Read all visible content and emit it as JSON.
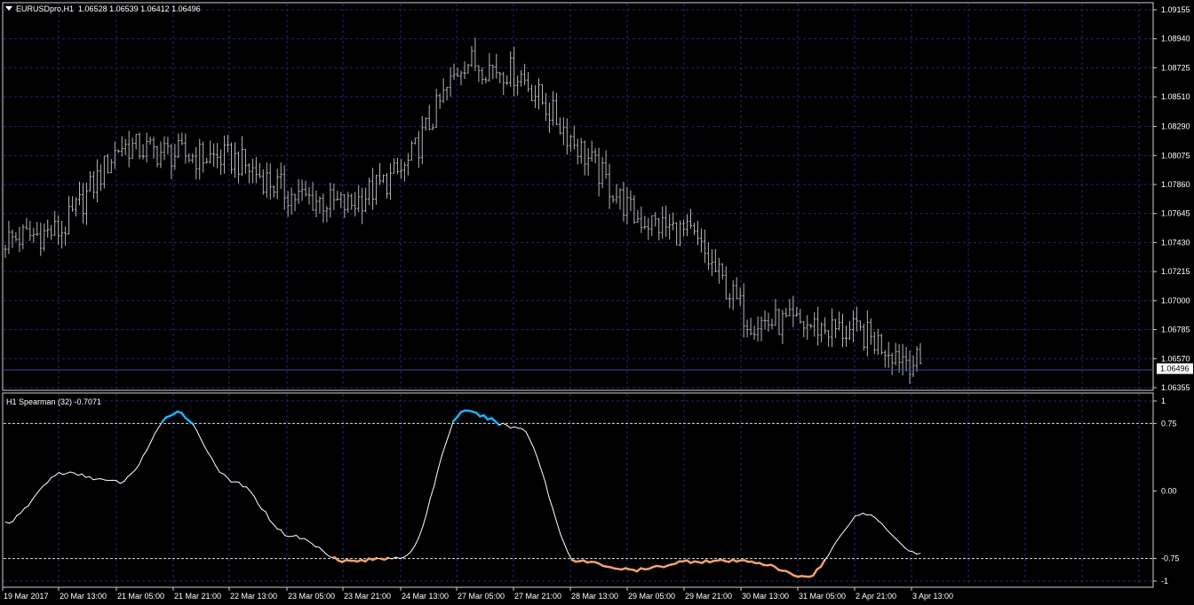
{
  "main": {
    "symbol": "EURUSDpro,H1",
    "ohlc": "1.06528 1.06539 1.06412 1.06496",
    "current_price": "1.06496",
    "price_ticks": [
      "1.09155",
      "1.08940",
      "1.08725",
      "1.08510",
      "1.08290",
      "1.08075",
      "1.07860",
      "1.07645",
      "1.07430",
      "1.07215",
      "1.07000",
      "1.06785",
      "1.06570",
      "1.06355"
    ],
    "time_ticks": [
      "19 Mar 2017",
      "20 Mar 13:00",
      "21 Mar 05:00",
      "21 Mar 21:00",
      "22 Mar 13:00",
      "23 Mar 05:00",
      "23 Mar 21:00",
      "24 Mar 13:00",
      "27 Mar 05:00",
      "27 Mar 21:00",
      "28 Mar 13:00",
      "29 Mar 05:00",
      "29 Mar 21:00",
      "30 Mar 13:00",
      "31 Mar 05:00",
      "2 Apr 21:00",
      "3 Apr 13:00"
    ]
  },
  "indicator": {
    "title": "H1 Spearman (32) -0.7071",
    "levels": [
      "1",
      "0.75",
      "0.00",
      "-0.75",
      "-1"
    ]
  },
  "colors": {
    "background": "#000000",
    "grid": "#1c2a6e",
    "bars": "#b4b4b4",
    "line": "#ffffff",
    "overbought": "#19b2ff",
    "oversold": "#f0a06e"
  },
  "chart_data": [
    {
      "type": "line",
      "title": "EURUSDpro,H1 (OHLC bars)",
      "ylim": [
        1.06355,
        1.09155
      ],
      "x": [
        "19 Mar 2017",
        "20 Mar 13:00",
        "21 Mar 05:00",
        "21 Mar 21:00",
        "22 Mar 13:00",
        "23 Mar 05:00",
        "23 Mar 21:00",
        "24 Mar 13:00",
        "27 Mar 05:00",
        "27 Mar 21:00",
        "28 Mar 13:00",
        "29 Mar 05:00",
        "29 Mar 21:00",
        "30 Mar 13:00",
        "31 Mar 05:00",
        "2 Apr 21:00",
        "3 Apr 13:00"
      ],
      "series": [
        {
          "name": "EURUSDpro,H1",
          "values": [
            1.0745,
            1.0752,
            1.0815,
            1.0808,
            1.0805,
            1.0778,
            1.077,
            1.0798,
            1.0878,
            1.0868,
            1.0815,
            1.0762,
            1.0748,
            1.0685,
            1.0682,
            1.0675,
            1.0652
          ]
        }
      ]
    },
    {
      "type": "line",
      "title": "H1 Spearman (32) -0.7071",
      "ylim": [
        -1,
        1
      ],
      "x": [
        "19 Mar 2017",
        "20 Mar 13:00",
        "21 Mar 05:00",
        "21 Mar 21:00",
        "22 Mar 13:00",
        "23 Mar 05:00",
        "23 Mar 21:00",
        "24 Mar 13:00",
        "27 Mar 05:00",
        "27 Mar 21:00",
        "28 Mar 13:00",
        "29 Mar 05:00",
        "29 Mar 21:00",
        "30 Mar 13:00",
        "31 Mar 05:00",
        "2 Apr 21:00",
        "3 Apr 13:00"
      ],
      "series": [
        {
          "name": "Spearman (32)",
          "values": [
            -0.35,
            0.2,
            0.1,
            0.88,
            0.1,
            -0.5,
            -0.78,
            -0.73,
            0.88,
            0.7,
            -0.78,
            -0.88,
            -0.78,
            -0.78,
            -0.95,
            -0.25,
            -0.7
          ]
        }
      ]
    }
  ]
}
